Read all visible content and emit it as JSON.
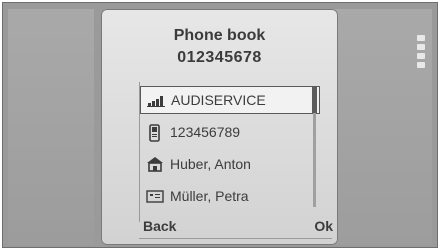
{
  "header": {
    "title": "Phone book",
    "number": "012345678"
  },
  "contacts": [
    {
      "name": "AUDISERVICE",
      "icon": "signal-icon",
      "selected": true
    },
    {
      "name": "123456789",
      "icon": "mobile-phone-icon",
      "selected": false
    },
    {
      "name": "Huber, Anton",
      "icon": "home-icon",
      "selected": false
    },
    {
      "name": "Müller, Petra",
      "icon": "office-icon",
      "selected": false
    }
  ],
  "softkeys": {
    "left": "Back",
    "right": "Ok"
  },
  "colors": {
    "bezel": "#9a9a9a",
    "screen_top": "#e7e7e7",
    "screen_bottom": "#d2d2d2",
    "text": "#3b3b3b",
    "selection_border": "#5a5a5a"
  }
}
